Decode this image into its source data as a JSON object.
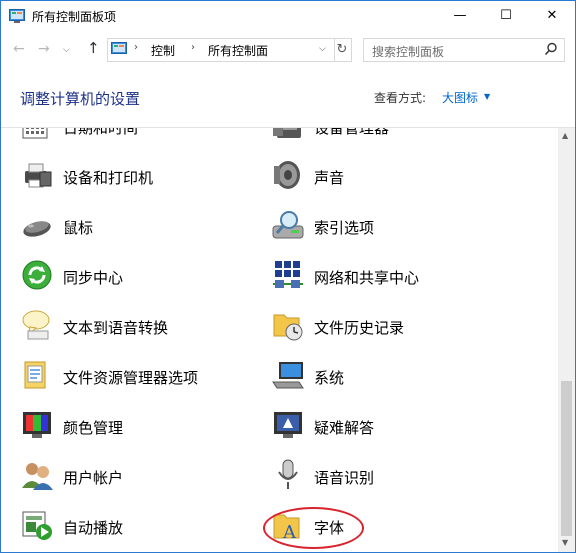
{
  "window": {
    "title": "所有控制面板项",
    "minimize": "—",
    "maximize": "☐",
    "close": "✕"
  },
  "nav": {
    "back": "←",
    "forward": "→",
    "recent": "⌵",
    "up": "↑",
    "breadcrumb": [
      "控制",
      "所有控制面"
    ],
    "separator": "›",
    "dropdown": "⌵",
    "refresh": "↻",
    "search_placeholder": "搜索控制面板"
  },
  "header": {
    "title": "调整计算机的设置",
    "view_label": "查看方式:",
    "view_value": "大图标",
    "view_dropdown": "▼"
  },
  "items_left": [
    {
      "label": "日期和时间",
      "icon": "calendar-icon"
    },
    {
      "label": "设备和打印机",
      "icon": "printer-icon"
    },
    {
      "label": "鼠标",
      "icon": "mouse-icon"
    },
    {
      "label": "同步中心",
      "icon": "sync-center-icon"
    },
    {
      "label": "文本到语音转换",
      "icon": "speech-bubble-icon"
    },
    {
      "label": "文件资源管理器选项",
      "icon": "folder-options-icon"
    },
    {
      "label": "颜色管理",
      "icon": "color-management-icon"
    },
    {
      "label": "用户帐户",
      "icon": "user-accounts-icon"
    },
    {
      "label": "自动播放",
      "icon": "autoplay-icon"
    }
  ],
  "items_right": [
    {
      "label": "设备管理器",
      "icon": "device-manager-icon"
    },
    {
      "label": "声音",
      "icon": "speaker-icon"
    },
    {
      "label": "索引选项",
      "icon": "indexing-icon"
    },
    {
      "label": "网络和共享中心",
      "icon": "network-icon"
    },
    {
      "label": "文件历史记录",
      "icon": "file-history-icon"
    },
    {
      "label": "系统",
      "icon": "system-icon"
    },
    {
      "label": "疑难解答",
      "icon": "troubleshooting-icon"
    },
    {
      "label": "语音识别",
      "icon": "microphone-icon"
    },
    {
      "label": "字体",
      "icon": "fonts-icon"
    }
  ],
  "scrollbar": {
    "up": "▲",
    "down": "▼"
  },
  "highlight": {
    "target": "字体",
    "color": "#d9232d"
  }
}
